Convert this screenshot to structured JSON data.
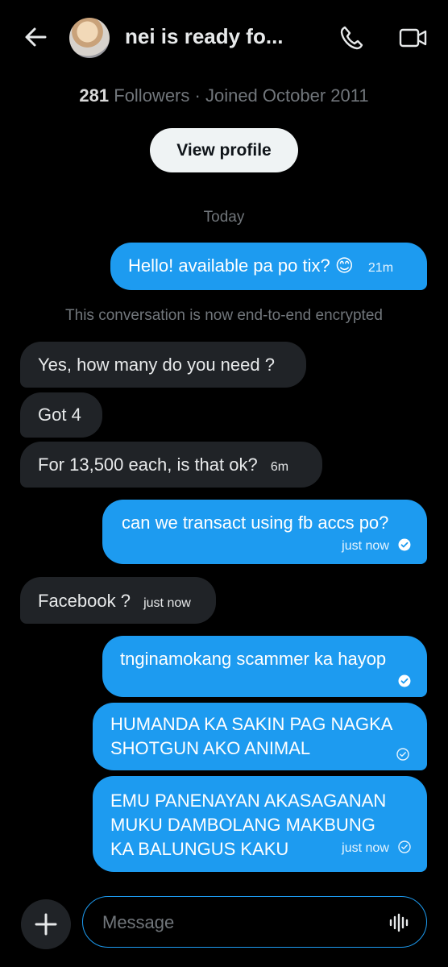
{
  "header": {
    "title": "nei is ready fo...",
    "followers_count": "281",
    "followers_label": "Followers",
    "joined_text": "· Joined October 2011",
    "view_profile_label": "View profile"
  },
  "conversation": {
    "date_separator": "Today",
    "encryption_notice": "This conversation is now end-to-end encrypted",
    "messages": [
      {
        "direction": "out",
        "text": "Hello! available pa po tix? 😊",
        "time": "21m"
      },
      {
        "direction": "in",
        "text": "Yes, how many do you need ?",
        "time": ""
      },
      {
        "direction": "in",
        "text": "Got 4",
        "time": ""
      },
      {
        "direction": "in",
        "text": "For 13,500 each, is that ok?",
        "time": "6m"
      },
      {
        "direction": "out",
        "text": "can we transact using fb accs po?",
        "time": "just now"
      },
      {
        "direction": "in",
        "text": "Facebook ?",
        "time": "just now"
      },
      {
        "direction": "out",
        "text": "tnginamokang scammer ka hayop",
        "time": ""
      },
      {
        "direction": "out",
        "text": "HUMANDA KA SAKIN PAG NAGKA SHOTGUN AKO ANIMAL",
        "time": ""
      },
      {
        "direction": "out",
        "text": "EMU PANENAYAN AKASAGANAN MUKU DAMBOLANG MAKBUNG KA BALUNGUS KAKU",
        "time": "just now"
      }
    ]
  },
  "composer": {
    "placeholder": "Message"
  },
  "icons": {
    "back": "arrow-left-icon",
    "call": "phone-icon",
    "video": "video-camera-icon",
    "add": "plus-icon",
    "voice": "audio-waveform-icon",
    "read_receipt": "check-circle-icon"
  },
  "colors": {
    "background": "#000000",
    "outgoing_bubble": "#1d9bf0",
    "incoming_bubble": "#202327",
    "muted_text": "#71767b"
  }
}
